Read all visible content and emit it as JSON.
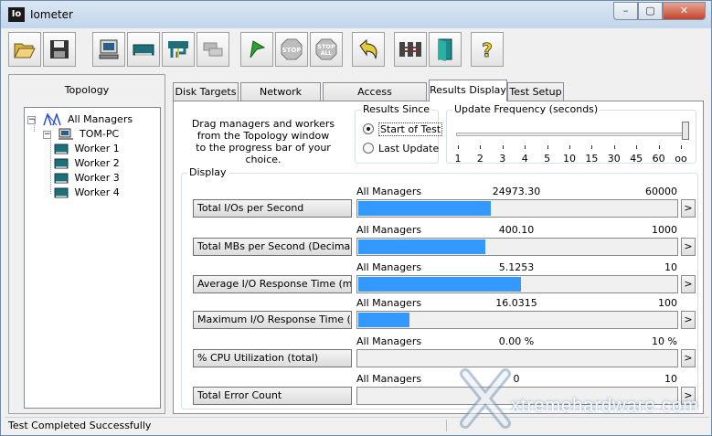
{
  "window": {
    "title": "Iometer",
    "icon_text": "Io",
    "min_label": "–",
    "max_label": "▢",
    "close_label": "✕"
  },
  "toolbar": {
    "buttons": [
      {
        "name": "open-config-button",
        "icon": "folder-open-icon"
      },
      {
        "name": "save-config-button",
        "icon": "floppy-disk-icon"
      },
      {
        "name": "new-disk-worker-button",
        "icon": "monitor-icon"
      },
      {
        "name": "new-network-worker-button",
        "icon": "network-card-icon"
      },
      {
        "name": "duplicate-worker-button",
        "icon": "fork-icon"
      },
      {
        "name": "disconnect-manager-button",
        "icon": "disconnect-icon"
      },
      {
        "name": "start-tests-button",
        "icon": "green-flag-icon"
      },
      {
        "name": "stop-button",
        "icon": "stop-sign-icon",
        "label": "STOP"
      },
      {
        "name": "stop-all-button",
        "icon": "stop-all-sign-icon",
        "label": "STOP",
        "sublabel": "ALL"
      },
      {
        "name": "reset-workers-button",
        "icon": "undo-arrow-icon"
      },
      {
        "name": "start-new-manager-button",
        "icon": "server-rack-icon"
      },
      {
        "name": "exit-button",
        "icon": "exit-door-icon"
      },
      {
        "name": "about-button",
        "icon": "question-mark-icon",
        "label": "?"
      }
    ]
  },
  "topology": {
    "title": "Topology",
    "root": "All Managers",
    "manager": "TOM-PC",
    "workers": [
      "Worker 1",
      "Worker 2",
      "Worker 3",
      "Worker 4"
    ]
  },
  "tabs": [
    {
      "label": "Disk Targets",
      "active": false
    },
    {
      "label": "Network Targets",
      "active": false
    },
    {
      "label": "Access Specifications",
      "active": false
    },
    {
      "label": "Results Display",
      "active": true
    },
    {
      "label": "Test Setup",
      "active": false
    }
  ],
  "results": {
    "instructions": [
      "Drag managers and workers",
      "from the Topology window",
      "to the progress bar of your choice."
    ],
    "results_since": {
      "legend": "Results Since",
      "options": [
        {
          "label": "Start of Test",
          "selected": true
        },
        {
          "label": "Last Update",
          "selected": false
        }
      ]
    },
    "update_frequency": {
      "legend": "Update Frequency (seconds)",
      "ticks": [
        "1",
        "2",
        "3",
        "4",
        "5",
        "10",
        "15",
        "30",
        "45",
        "60",
        "oo"
      ],
      "selected_index": 10
    },
    "display": {
      "legend": "Display",
      "arrow_label": ">",
      "metrics": [
        {
          "button": "Total I/Os per Second",
          "source": "All Managers",
          "value": "24973.30",
          "max": "60000",
          "fraction": 0.4162
        },
        {
          "button": "Total MBs per Second (Decimal)",
          "source": "All Managers",
          "value": "400.10",
          "max": "1000",
          "fraction": 0.4001
        },
        {
          "button": "Average I/O Response Time (ms)",
          "source": "All Managers",
          "value": "5.1253",
          "max": "10",
          "fraction": 0.5125
        },
        {
          "button": "Maximum I/O Response Time (ms)",
          "source": "All Managers",
          "value": "16.0315",
          "max": "100",
          "fraction": 0.1603
        },
        {
          "button": "% CPU Utilization (total)",
          "source": "All Managers",
          "value": "0.00 %",
          "max": "10 %",
          "fraction": 0.0
        },
        {
          "button": "Total Error Count",
          "source": "All Managers",
          "value": "0",
          "max": "10",
          "fraction": 0.0
        }
      ]
    }
  },
  "status": {
    "text": "Test Completed Successfully"
  },
  "watermark": {
    "text": "xtremehardware.com"
  }
}
